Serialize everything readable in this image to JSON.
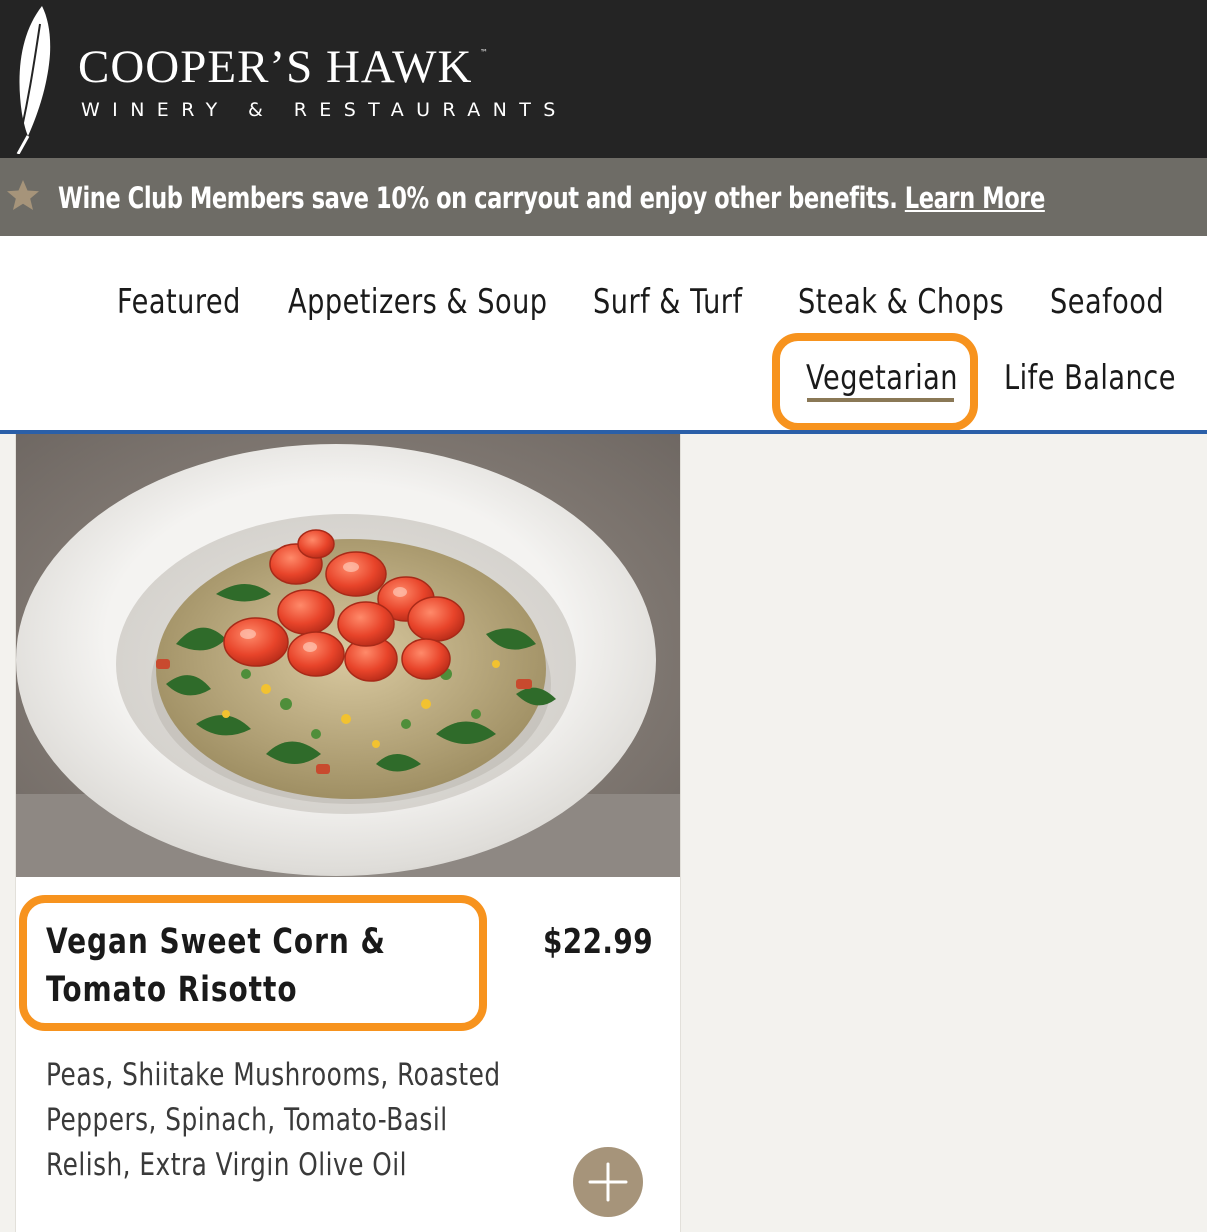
{
  "header": {
    "brand_name": "COOPER’S HAWK",
    "brand_tm": "™",
    "brand_subtitle": "WINERY & RESTAURANTS",
    "logo_icon": "feather-icon",
    "background_color": "#242424"
  },
  "promo": {
    "icon": "star-icon",
    "text": "Wine Club Members save 10% on carryout and enjoy other benefits. ",
    "link_label": "Learn More",
    "background_color": "#6e6c66",
    "star_color": "#a6947a"
  },
  "nav": {
    "items": [
      {
        "label": "Featured"
      },
      {
        "label": "Appetizers & Soup"
      },
      {
        "label": "Surf & Turf"
      },
      {
        "label": "Steak & Chops"
      },
      {
        "label": "Seafood"
      },
      {
        "label": "Vegetarian",
        "active": true
      },
      {
        "label": "Life Balance"
      }
    ],
    "active_underline_color": "#8a7856",
    "border_color": "#2a5fa8"
  },
  "menu_item": {
    "name": "Vegan Sweet Corn & Tomato Risotto",
    "price": "$22.99",
    "description": "Peas, Shiitake Mushrooms, Roasted Peppers, Spinach, Tomato-Basil Relish, Extra Virgin Olive Oil",
    "add_icon": "plus-icon",
    "add_button_color": "#a6947a"
  },
  "highlight_color": "#f7931e"
}
